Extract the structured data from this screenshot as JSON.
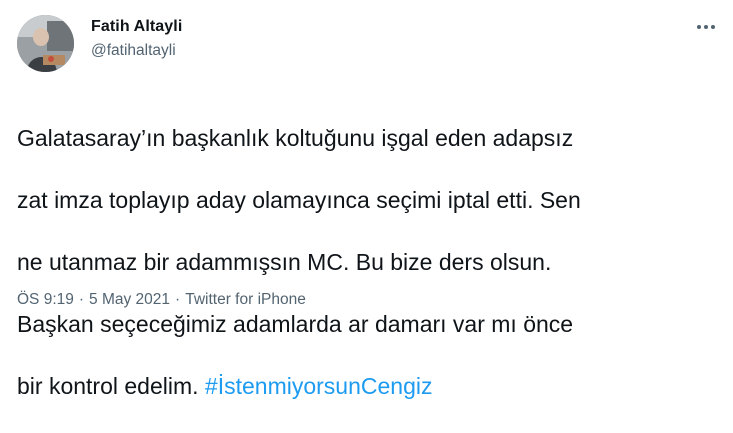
{
  "author": {
    "name": "Fatih Altayli",
    "handle": "@fatihaltayli",
    "avatar_icon": "profile-photo"
  },
  "more_icon": "more-options-icon",
  "tweet": {
    "lines": [
      "Galatasaray’ın başkanlık koltuğunu işgal eden adapsız",
      "zat imza toplayıp aday olamayınca seçimi iptal etti. Sen",
      "ne utanmaz bir adammışsın MC. Bu bize ders olsun.",
      "Başkan seçeceğimiz adamlarda ar damarı var mı önce",
      "bir kontrol edelim."
    ],
    "hashtag": "#İstenmiyorsunCengiz"
  },
  "meta": {
    "time": "ÖS 9:19",
    "separator": "·",
    "date": "5 May 2021",
    "source": "Twitter for iPhone"
  },
  "colors": {
    "text": "#0f1419",
    "secondary": "#536471",
    "link": "#1d9bf0"
  }
}
